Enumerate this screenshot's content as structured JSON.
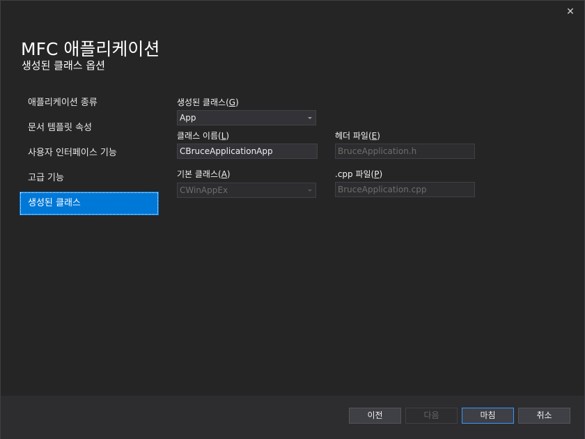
{
  "dialog": {
    "title": "MFC 애플리케이션",
    "subtitle": "생성된 클래스 옵션",
    "close_glyph": "✕"
  },
  "nav": {
    "items": [
      {
        "label": "애플리케이션 종류"
      },
      {
        "label": "문서 템플릿 속성"
      },
      {
        "label": "사용자 인터페이스 기능"
      },
      {
        "label": "고급 기능"
      },
      {
        "label": "생성된 클래스"
      }
    ],
    "active_index": 4
  },
  "form": {
    "generated_classes": {
      "label": "생성된 클래스",
      "hotkey": "G",
      "value": "App"
    },
    "class_name": {
      "label": "클래스 이름",
      "hotkey": "L",
      "value": "CBruceApplicationApp"
    },
    "header_file": {
      "label": "헤더 파일",
      "hotkey": "E",
      "value": "BruceApplication.h"
    },
    "base_class": {
      "label": "기본 클래스",
      "hotkey": "A",
      "value": "CWinAppEx"
    },
    "cpp_file": {
      "label": ".cpp 파일",
      "hotkey": "P",
      "value": "BruceApplication.cpp"
    }
  },
  "buttons": {
    "prev": "이전",
    "next": "다음",
    "finish": "마침",
    "cancel": "취소"
  },
  "colors": {
    "background": "#252526",
    "accent": "#0078d7",
    "footer": "#2d2d30"
  }
}
